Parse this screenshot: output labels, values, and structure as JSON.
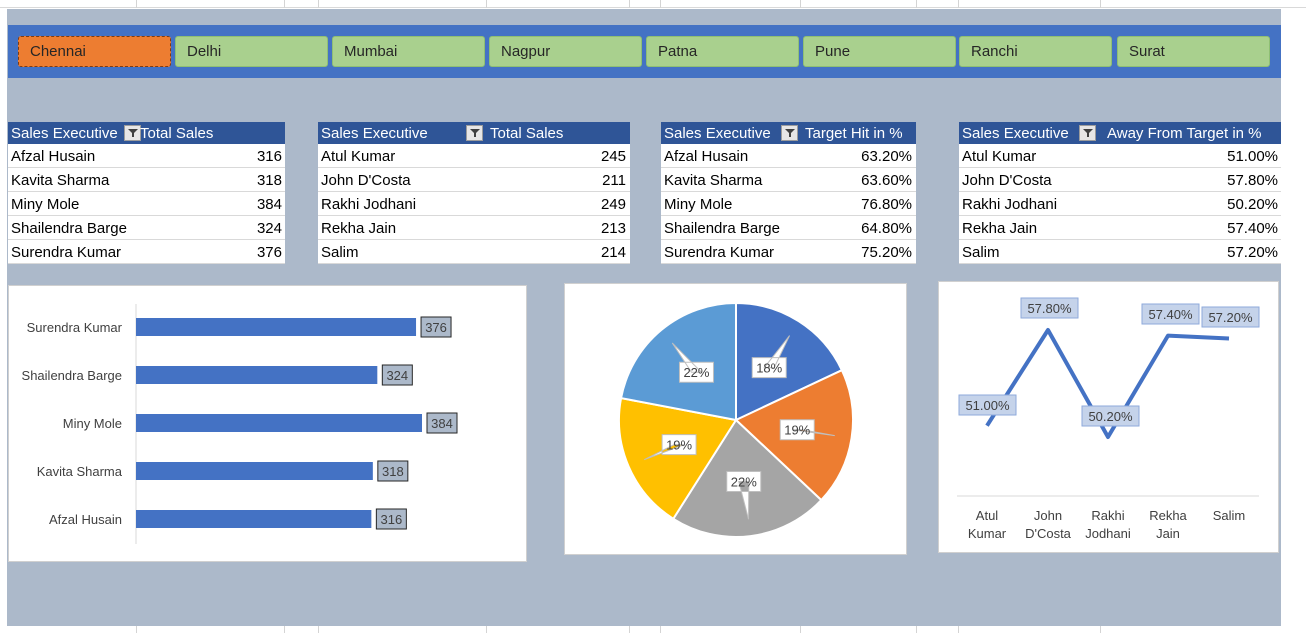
{
  "slicer": {
    "items": [
      "Chennai",
      "Delhi",
      "Mumbai",
      "Nagpur",
      "Patna",
      "Pune",
      "Ranchi",
      "Surat"
    ],
    "selected": "Chennai"
  },
  "tables": [
    {
      "headers": [
        "Sales Executive",
        "Total Sales"
      ],
      "rows": [
        [
          "Afzal Husain",
          "316"
        ],
        [
          "Kavita Sharma",
          "318"
        ],
        [
          "Miny Mole",
          "384"
        ],
        [
          "Shailendra Barge",
          "324"
        ],
        [
          "Surendra Kumar",
          "376"
        ]
      ]
    },
    {
      "headers": [
        "Sales Executive",
        "Total Sales"
      ],
      "rows": [
        [
          "Atul Kumar",
          "245"
        ],
        [
          "John D'Costa",
          "211"
        ],
        [
          "Rakhi Jodhani",
          "249"
        ],
        [
          "Rekha Jain",
          "213"
        ],
        [
          "Salim",
          "214"
        ]
      ]
    },
    {
      "headers": [
        "Sales Executive",
        "Target Hit in %"
      ],
      "rows": [
        [
          "Afzal Husain",
          "63.20%"
        ],
        [
          "Kavita Sharma",
          "63.60%"
        ],
        [
          "Miny Mole",
          "76.80%"
        ],
        [
          "Shailendra Barge",
          "64.80%"
        ],
        [
          "Surendra Kumar",
          "75.20%"
        ]
      ]
    },
    {
      "headers": [
        "Sales Executive",
        "Away From Target in %"
      ],
      "rows": [
        [
          "Atul Kumar",
          "51.00%"
        ],
        [
          "John D'Costa",
          "57.80%"
        ],
        [
          "Rakhi Jodhani",
          "50.20%"
        ],
        [
          "Rekha Jain",
          "57.40%"
        ],
        [
          "Salim",
          "57.20%"
        ]
      ]
    }
  ],
  "colors": {
    "slicer_bg": "#4472c4",
    "slicer_item": "#a9d08e",
    "slicer_selected": "#ed7d31",
    "table_header": "#2f5597",
    "dashboard_bg": "#acb9ca",
    "bar": "#4472c4",
    "line": "#4472c4"
  },
  "chart_data": [
    {
      "type": "bar",
      "orientation": "horizontal",
      "categories": [
        "Surendra Kumar",
        "Shailendra Barge",
        "Miny Mole",
        "Kavita Sharma",
        "Afzal Husain"
      ],
      "values": [
        376,
        324,
        384,
        318,
        316
      ],
      "data_labels": [
        "376",
        "324",
        "384",
        "318",
        "316"
      ],
      "legend": "none"
    },
    {
      "type": "pie",
      "values": [
        18,
        19,
        22,
        19,
        22
      ],
      "data_labels": [
        "18%",
        "19%",
        "22%",
        "19%",
        "22%"
      ],
      "colors": [
        "#4472c4",
        "#ed7d31",
        "#a5a5a5",
        "#ffc000",
        "#5b9bd5"
      ],
      "legend": "none"
    },
    {
      "type": "line",
      "categories": [
        "Atul Kumar",
        "John D'Costa",
        "Rakhi Jodhani",
        "Rekha Jain",
        "Salim"
      ],
      "category_label_lines": [
        [
          "Atul",
          "Kumar"
        ],
        [
          "John",
          "D'Costa"
        ],
        [
          "Rakhi",
          "Jodhani"
        ],
        [
          "Rekha",
          "Jain"
        ],
        [
          "Salim"
        ]
      ],
      "values": [
        51.0,
        57.8,
        50.2,
        57.4,
        57.2
      ],
      "data_labels": [
        "51.00%",
        "57.80%",
        "50.20%",
        "57.40%",
        "57.20%"
      ],
      "legend": "none"
    }
  ]
}
